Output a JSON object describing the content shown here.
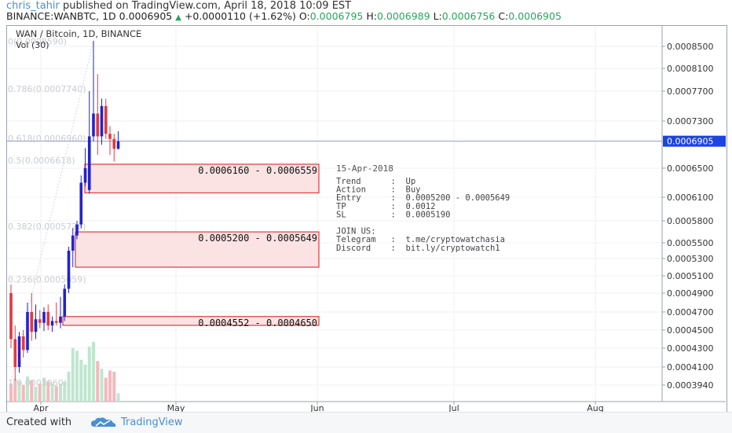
{
  "header": {
    "author": "chris_tahir",
    "published": "published on TradingView.com, April 18, 2018 10:09 EST",
    "symbol": "BINANCE:WANBTC, 1D",
    "last": "0.0006905",
    "change_arrow": "▲",
    "change": "+0.0000110 (+1.62%)",
    "o_label": "O:",
    "o": "0.0006795",
    "h_label": "H:",
    "h": "0.0006989",
    "l_label": "L:",
    "l": "0.0006756",
    "c_label": "C:",
    "c": "0.0006905"
  },
  "chart_title": "WAN / Bitcoin, 1D, BINANCE",
  "volume_label": "Vol (30)",
  "footer": {
    "created_with": "Created with",
    "brand": "TradingView",
    "logo_icon": "cloud-logo-icon"
  },
  "colors": {
    "up": "#2222cc",
    "down": "#e0393e",
    "zone_border": "#e0393e",
    "zone_fill": "#fbe3e3",
    "price_line": "#9a9ad8",
    "price_tag": "#1e44e0",
    "vol_up": "#bfe6cf",
    "vol_down": "#f3b9bd"
  },
  "zones_text": [
    "0.0006160 - 0.0006559",
    "0.0005200 - 0.0005649",
    "0.0004552 - 0.0004650"
  ],
  "fib_labels": [
    "0(0.0008590)",
    "0.786(0.0007740)",
    "0.618(0.0006960)",
    "0.5(0.0006618)",
    "0.382(0.0005726)",
    "0.236(0.0005059)",
    "1(0.0003960)"
  ],
  "note": {
    "date": "15-Apr-2018",
    "lines": [
      "Trend      :  Up",
      "Action     :  Buy",
      "Entry      :  0.0005200 - 0.0005649",
      "TP         :  0.0012",
      "SL         :  0.0005190",
      "",
      "JOIN US:",
      "Telegram   :  t.me/cryptowatchasia",
      "Discord    :  bit.ly/cryptowatch1"
    ]
  },
  "chart_data": {
    "type": "candlestick",
    "title": "WAN / Bitcoin, 1D, BINANCE",
    "y_ticks": [
      0.000394,
      0.00041,
      0.00043,
      0.00045,
      0.00047,
      0.00049,
      0.00051,
      0.00053,
      0.00055,
      0.00058,
      0.00061,
      0.00065,
      0.00069,
      0.00073,
      0.00077,
      0.00081,
      0.00085
    ],
    "y_tick_labels": [
      "0.0003940",
      "0.0004100",
      "0.0004300",
      "0.0004500",
      "0.0004700",
      "0.0004900",
      "0.0005100",
      "0.0005300",
      "0.0005500",
      "0.0005800",
      "0.0006100",
      "0.0006500",
      "0.0006905",
      "0.0007300",
      "0.0007700",
      "0.0008100",
      "0.0008500"
    ],
    "last_price": 0.0006905,
    "x_tick_labels": [
      "Apr",
      "May",
      "Jun",
      "Jul",
      "Aug"
    ],
    "candles": [
      {
        "o": 0.00049,
        "h": 0.0005,
        "l": 0.00043,
        "c": 0.00044
      },
      {
        "o": 0.00044,
        "h": 0.000455,
        "l": 0.000398,
        "c": 0.00041
      },
      {
        "o": 0.00041,
        "h": 0.000448,
        "l": 0.000405,
        "c": 0.000443
      },
      {
        "o": 0.000443,
        "h": 0.00045,
        "l": 0.00042,
        "c": 0.000428
      },
      {
        "o": 0.000428,
        "h": 0.00048,
        "l": 0.000425,
        "c": 0.00047
      },
      {
        "o": 0.00047,
        "h": 0.00049,
        "l": 0.000438,
        "c": 0.000448
      },
      {
        "o": 0.000448,
        "h": 0.000478,
        "l": 0.00044,
        "c": 0.000462
      },
      {
        "o": 0.000462,
        "h": 0.000472,
        "l": 0.000452,
        "c": 0.000458
      },
      {
        "o": 0.000458,
        "h": 0.000475,
        "l": 0.000449,
        "c": 0.00047
      },
      {
        "o": 0.00047,
        "h": 0.000478,
        "l": 0.00045,
        "c": 0.000455
      },
      {
        "o": 0.000455,
        "h": 0.000465,
        "l": 0.000448,
        "c": 0.00046
      },
      {
        "o": 0.00046,
        "h": 0.00048,
        "l": 0.000455,
        "c": 0.000458
      },
      {
        "o": 0.000458,
        "h": 0.000486,
        "l": 0.000452,
        "c": 0.000465
      },
      {
        "o": 0.000465,
        "h": 0.0005,
        "l": 0.00046,
        "c": 0.000495
      },
      {
        "o": 0.000495,
        "h": 0.000545,
        "l": 0.00049,
        "c": 0.00054
      },
      {
        "o": 0.00054,
        "h": 0.00057,
        "l": 0.00052,
        "c": 0.00056
      },
      {
        "o": 0.00056,
        "h": 0.00058,
        "l": 0.000555,
        "c": 0.000575
      },
      {
        "o": 0.000575,
        "h": 0.00064,
        "l": 0.00057,
        "c": 0.00063
      },
      {
        "o": 0.00063,
        "h": 0.00068,
        "l": 0.000625,
        "c": 0.00065
      },
      {
        "o": 0.00062,
        "h": 0.00077,
        "l": 0.000615,
        "c": 0.0007
      },
      {
        "o": 0.0007,
        "h": 0.00086,
        "l": 0.00069,
        "c": 0.00074
      },
      {
        "o": 0.00074,
        "h": 0.0008,
        "l": 0.00067,
        "c": 0.0007
      },
      {
        "o": 0.0007,
        "h": 0.00076,
        "l": 0.000685,
        "c": 0.00075
      },
      {
        "o": 0.00075,
        "h": 0.00076,
        "l": 0.000695,
        "c": 0.000705
      },
      {
        "o": 0.000705,
        "h": 0.00072,
        "l": 0.00067,
        "c": 0.000695
      },
      {
        "o": 0.000695,
        "h": 0.000705,
        "l": 0.00066,
        "c": 0.000679
      },
      {
        "o": 0.000679,
        "h": 0.00071,
        "l": 0.000678,
        "c": 0.00069
      }
    ],
    "volumes": [
      0.3,
      0.38,
      0.34,
      0.28,
      0.42,
      0.36,
      0.25,
      0.3,
      0.4,
      0.34,
      0.3,
      0.26,
      0.3,
      0.33,
      0.5,
      0.9,
      0.85,
      0.7,
      0.62,
      0.92,
      1.0,
      0.68,
      0.55,
      0.4,
      0.52,
      0.5,
      0.14
    ],
    "zones": [
      {
        "low": 0.000616,
        "high": 0.0006559
      },
      {
        "low": 0.00052,
        "high": 0.0005649
      },
      {
        "low": 0.0004552,
        "high": 0.000465
      }
    ],
    "fib_levels": [
      0.000859,
      0.000774,
      0.000696,
      0.0006618,
      0.0005726,
      0.0005059,
      0.000396
    ]
  }
}
